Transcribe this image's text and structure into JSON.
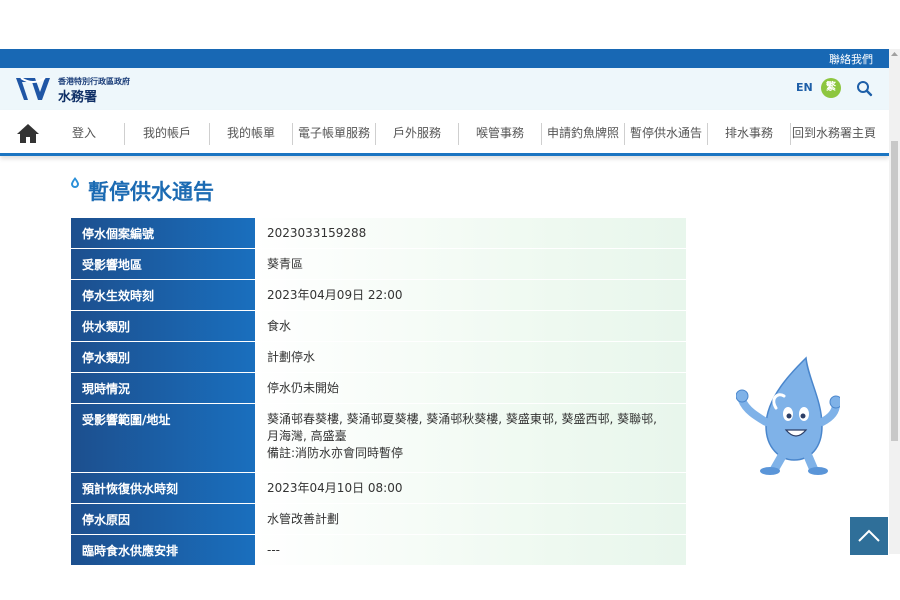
{
  "topbar": {
    "contact_label": "聯絡我們"
  },
  "header": {
    "gov_name": "香港特別行政區政府",
    "dept_name": "水務署",
    "lang_en": "EN",
    "lang_tc": "繁",
    "search_icon": "search-icon"
  },
  "nav": {
    "home_icon": "home-icon",
    "items": [
      {
        "label": "登入"
      },
      {
        "label": "我的帳戶"
      },
      {
        "label": "我的帳單"
      },
      {
        "label": "電子帳單服務"
      },
      {
        "label": "戶外服務"
      },
      {
        "label": "喉管事務"
      },
      {
        "label": "申請釣魚牌照"
      },
      {
        "label": "暫停供水通告"
      },
      {
        "label": "排水事務"
      },
      {
        "label": "回到水務署主頁"
      }
    ]
  },
  "page": {
    "title": "暫停供水通告"
  },
  "notice": {
    "rows": [
      {
        "label": "停水個案編號",
        "value": "2023033159288"
      },
      {
        "label": "受影響地區",
        "value": "葵青區"
      },
      {
        "label": "停水生效時刻",
        "value": "2023年04月09日 22:00"
      },
      {
        "label": "供水類別",
        "value": "食水"
      },
      {
        "label": "停水類別",
        "value": "計劃停水"
      },
      {
        "label": "現時情況",
        "value": "停水仍未開始"
      },
      {
        "label": "受影響範圍/地址",
        "value_line1": "葵涌邨春葵樓, 葵涌邨夏葵樓, 葵涌邨秋葵樓, 葵盛東邨, 葵盛西邨, 葵聯邨,",
        "value_line2": "月海灣, 高盛臺",
        "value_line3": "備註:消防水亦會同時暫停"
      },
      {
        "label": "預計恢復供水時刻",
        "value": "2023年04月10日 08:00"
      },
      {
        "label": "停水原因",
        "value": "水管改善計劃"
      },
      {
        "label": "臨時食水供應安排",
        "value": "---"
      }
    ]
  },
  "colors": {
    "brand_blue": "#1868b4",
    "label_gradient_start": "#1c4f8e",
    "label_gradient_end": "#1a6fbe",
    "accent_green": "#8dc63f"
  }
}
